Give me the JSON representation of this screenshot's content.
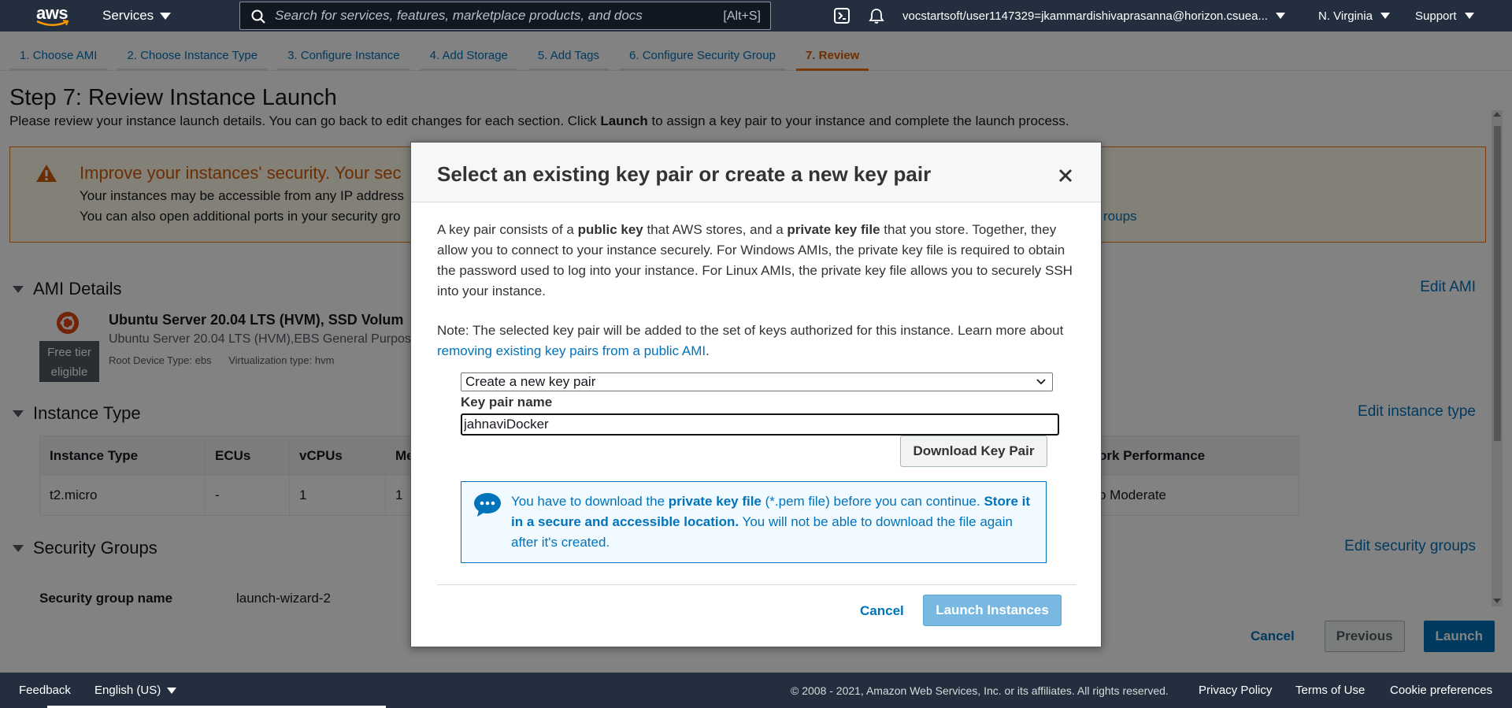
{
  "topnav": {
    "logo": "aws",
    "services_label": "Services",
    "search_placeholder": "Search for services, features, marketplace products, and docs",
    "search_shortcut": "[Alt+S]",
    "account": "vocstartsoft/user1147329=jkammardishivaprasanna@horizon.csuea...",
    "region": "N. Virginia",
    "support": "Support",
    "icons": [
      "cloudshell-icon",
      "bell-icon"
    ]
  },
  "wizard": {
    "steps": [
      "1. Choose AMI",
      "2. Choose Instance Type",
      "3. Configure Instance",
      "4. Add Storage",
      "5. Add Tags",
      "6. Configure Security Group",
      "7. Review"
    ],
    "active_index": 6
  },
  "review": {
    "title": "Step 7: Review Instance Launch",
    "intro_pre": "Please review your instance launch details. You can go back to edit changes for each section. Click ",
    "intro_bold": "Launch",
    "intro_post": " to assign a key pair to your instance and complete the launch process.",
    "warning": {
      "title": "Improve your instances' security. Your sec",
      "line1": "Your instances may be accessible from any IP address",
      "line2": "You can also open additional ports in your security gro",
      "link_fragment": "roups"
    },
    "ami": {
      "heading": "AMI Details",
      "edit": "Edit AMI",
      "name": "Ubuntu Server 20.04 LTS (HVM), SSD Volum",
      "desc": "Ubuntu Server 20.04 LTS (HVM),EBS General Purpos",
      "root_device": "Root Device Type: ebs",
      "virt": "Virtualization type: hvm",
      "free_tier_1": "Free tier",
      "free_tier_2": "eligible"
    },
    "instance": {
      "heading": "Instance Type",
      "edit": "Edit instance type",
      "columns": [
        "Instance Type",
        "ECUs",
        "vCPUs",
        "Me",
        "ork Performance"
      ],
      "row": [
        "t2.micro",
        "-",
        "1",
        "1",
        "o Moderate"
      ]
    },
    "security": {
      "heading": "Security Groups",
      "edit": "Edit security groups",
      "name_label": "Security group name",
      "name_value": "launch-wizard-2"
    },
    "actions": {
      "cancel": "Cancel",
      "previous": "Previous",
      "launch": "Launch"
    }
  },
  "modal": {
    "title": "Select an existing key pair or create a new key pair",
    "close": "×",
    "p1": [
      {
        "t": "A key pair consists of a ",
        "b": false
      },
      {
        "t": "public key",
        "b": true
      },
      {
        "t": " that AWS stores, and a ",
        "b": false
      },
      {
        "t": "private key file",
        "b": true
      },
      {
        "t": " that you store. Together, they allow you to connect to your instance securely. For Windows AMIs, the private key file is required to obtain the password used to log into your instance. For Linux AMIs, the private key file allows you to securely SSH into your instance.",
        "b": false
      }
    ],
    "p2_text": "Note: The selected key pair will be added to the set of keys authorized for this instance. Learn more about ",
    "p2_link": "removing existing key pairs from a public AMI",
    "p2_end": ".",
    "select_value": "Create a new key pair",
    "key_name_label": "Key pair name",
    "key_name_value": "jahnaviDocker",
    "download_button": "Download Key Pair",
    "info": [
      {
        "t": "You have to download the ",
        "b": false
      },
      {
        "t": "private key file",
        "b": true
      },
      {
        "t": " (*.pem file) before you can continue. ",
        "b": false
      },
      {
        "t": "Store it in a secure and accessible location.",
        "b": true
      },
      {
        "t": " You will not be able to download the file again after it's created.",
        "b": false
      }
    ],
    "cancel": "Cancel",
    "launch_instances": "Launch Instances"
  },
  "footer": {
    "feedback": "Feedback",
    "language": "English (US)",
    "copyright": "© 2008 - 2021, Amazon Web Services, Inc. or its affiliates. All rights reserved.",
    "privacy": "Privacy Policy",
    "terms": "Terms of Use",
    "cookies": "Cookie preferences"
  },
  "colors": {
    "nav_bg": "#232f3e",
    "link": "#0073bb",
    "warning": "#ec7211",
    "launch_disabled": "#79b9e1"
  }
}
